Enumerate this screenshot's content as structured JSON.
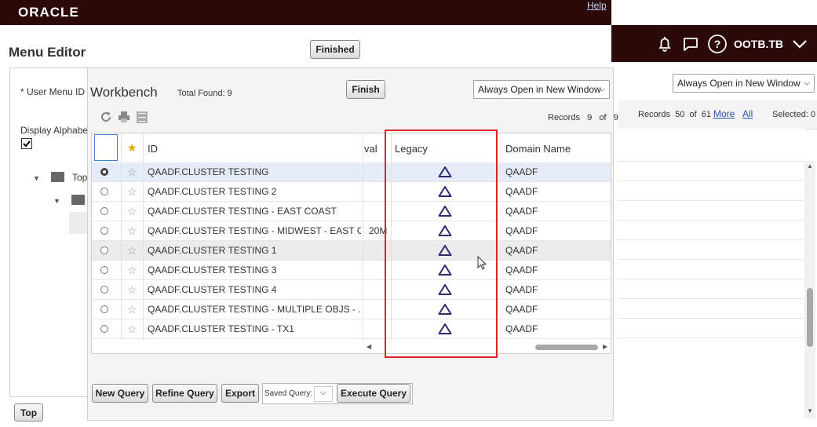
{
  "oracle_bar": {
    "logo": "ORACLE",
    "help": "Help"
  },
  "right_header": {
    "user": "OOTB.TB"
  },
  "menu_editor": {
    "title": "Menu Editor",
    "finished_label": "Finished",
    "user_menu_label": "* User Menu ID",
    "display_alpha_label": "Display Alphabe",
    "tree_top_label": "Top",
    "top_button": "Top"
  },
  "right_panel": {
    "open_mode": "Always Open in New Window",
    "records_label": "Records",
    "records_current": "50",
    "records_of": "of",
    "records_total": "61",
    "more": "More",
    "all": "All",
    "selected_label": "Selected: 0"
  },
  "workbench": {
    "title": "Workbench",
    "total_found": "Total Found: 9",
    "finish_label": "Finish",
    "open_mode": "Always Open in New Window",
    "records_label": "Records",
    "records_current": "9",
    "records_of": "of",
    "records_total": "9",
    "columns": {
      "id": "ID",
      "val": "val",
      "legacy": "Legacy",
      "domain": "Domain Name"
    },
    "rows": [
      {
        "id": "QAADF.CLUSTER TESTING",
        "val": "",
        "domain": "QAADF",
        "selected": true
      },
      {
        "id": "QAADF.CLUSTER TESTING 2",
        "val": "",
        "domain": "QAADF"
      },
      {
        "id": "QAADF.CLUSTER TESTING - EAST COAST",
        "val": "",
        "domain": "QAADF"
      },
      {
        "id": "QAADF.CLUSTER TESTING - MIDWEST - EAST C...",
        "val": "20M",
        "domain": "QAADF"
      },
      {
        "id": "QAADF.CLUSTER TESTING 1",
        "val": "",
        "domain": "QAADF"
      },
      {
        "id": "QAADF.CLUSTER TESTING 3",
        "val": "",
        "domain": "QAADF"
      },
      {
        "id": "QAADF.CLUSTER TESTING 4",
        "val": "",
        "domain": "QAADF"
      },
      {
        "id": "QAADF.CLUSTER TESTING - MULTIPLE OBJS - ...",
        "val": "",
        "domain": "QAADF"
      },
      {
        "id": "QAADF.CLUSTER TESTING - TX1",
        "val": "",
        "domain": "QAADF"
      }
    ],
    "new_query": "New Query",
    "refine_query": "Refine Query",
    "export": "Export",
    "saved_query": "Saved Query:",
    "execute_query": "Execute Query"
  },
  "colors": {
    "header_bg": "#2b0909",
    "highlight_box": "#d9262c",
    "row_selected": "#e4ecf7",
    "row_hover": "#ececec"
  }
}
